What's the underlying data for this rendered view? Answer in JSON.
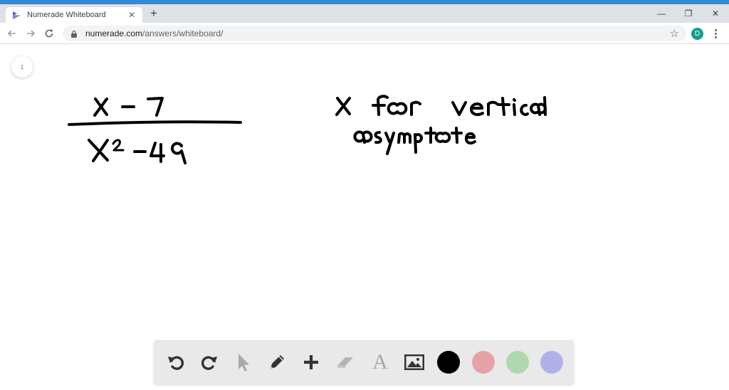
{
  "browser": {
    "tab_title": "Numerade Whiteboard",
    "tab_close": "✕",
    "new_tab": "+",
    "url_host": "numerade.com",
    "url_path": "/answers/whiteboard/",
    "avatar_initial": "D",
    "window_controls": {
      "minimize": "—",
      "maximize": "❐",
      "close": "✕"
    },
    "accent_color": "#2f8ad8"
  },
  "whiteboard": {
    "page_number": "1",
    "handwriting": {
      "numerator": "x − 7",
      "denominator": "x² − 49",
      "note_line1": "x for vertical",
      "note_line2": "asymptote"
    }
  },
  "toolbar": {
    "tools": [
      "undo-icon",
      "redo-icon",
      "pointer-icon",
      "pencil-icon",
      "plus-icon",
      "eraser-icon",
      "text-icon",
      "image-icon"
    ],
    "text_tool_glyph": "A",
    "colors": [
      "#000000",
      "#e5a3a8",
      "#b0d8ad",
      "#b0b1ea"
    ]
  }
}
